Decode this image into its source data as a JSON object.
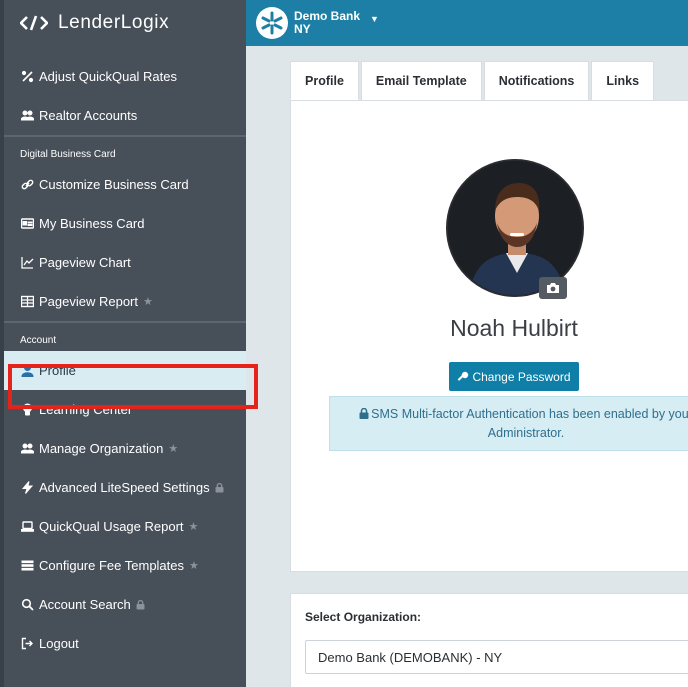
{
  "brand": {
    "name": "LenderLogix"
  },
  "topbar": {
    "bank_name": "Demo Bank",
    "bank_state": "NY"
  },
  "sidebar": {
    "items_top": [
      {
        "label": "Adjust QuickQual Rates",
        "icon": "percent-icon"
      },
      {
        "label": "Realtor Accounts",
        "icon": "users-icon"
      }
    ],
    "section_business_card": "Digital Business Card",
    "items_card": [
      {
        "label": "Customize Business Card",
        "icon": "link-icon"
      },
      {
        "label": "My Business Card",
        "icon": "id-card-icon"
      },
      {
        "label": "Pageview Chart",
        "icon": "line-chart-icon"
      },
      {
        "label": "Pageview Report",
        "icon": "table-icon",
        "star": true
      }
    ],
    "section_account": "Account",
    "items_account": [
      {
        "label": "Profile",
        "icon": "user-icon",
        "active": true
      },
      {
        "label": "Learning Center",
        "icon": "lightbulb-icon"
      },
      {
        "label": "Manage Organization",
        "icon": "users-icon",
        "star": true
      },
      {
        "label": "Advanced LiteSpeed Settings",
        "icon": "bolt-icon",
        "lock": true
      },
      {
        "label": "QuickQual Usage Report",
        "icon": "laptop-icon",
        "star": true
      },
      {
        "label": "Configure Fee Templates",
        "icon": "bars-icon",
        "star": true
      },
      {
        "label": "Account Search",
        "icon": "search-icon",
        "lock": true
      },
      {
        "label": "Logout",
        "icon": "logout-icon"
      }
    ]
  },
  "tabs": [
    "Profile",
    "Email Template",
    "Notifications",
    "Links"
  ],
  "profile": {
    "name": "Noah Hulbirt",
    "change_password": "Change Password",
    "mfa_notice": "SMS Multi-factor Authentication has been enabled by your Administrator."
  },
  "organization": {
    "label": "Select Organization:",
    "selected": "Demo Bank (DEMOBANK) - NY"
  },
  "colors": {
    "sidebar": "#474f59",
    "topbar": "#1d7fa6",
    "button": "#0f7fa8",
    "highlight": "#e5231b"
  }
}
